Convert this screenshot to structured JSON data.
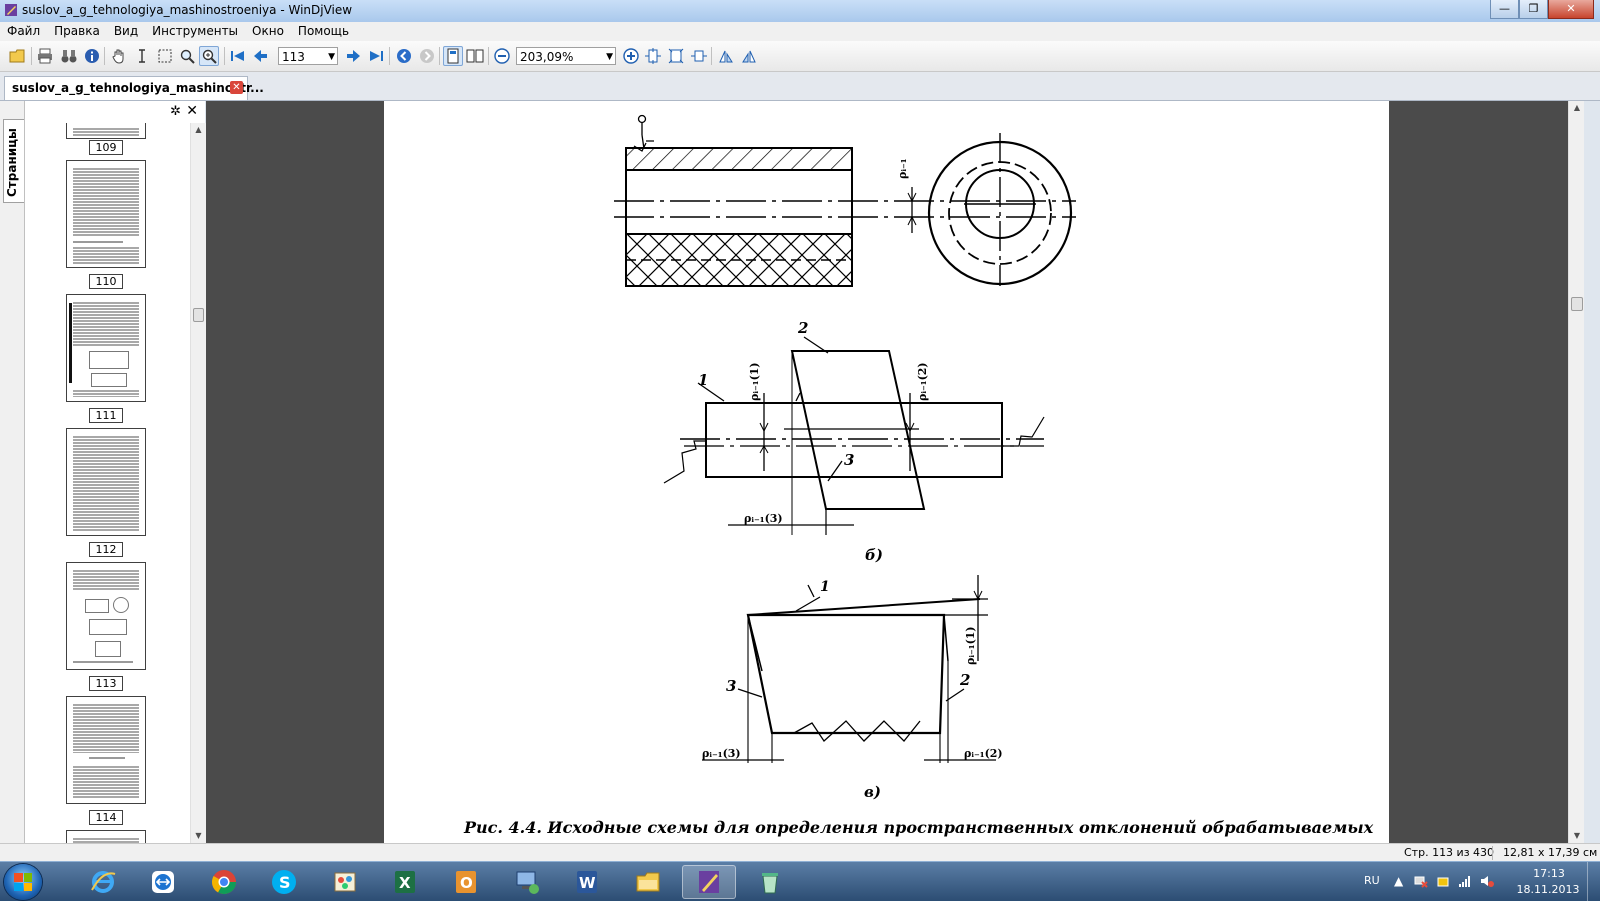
{
  "window": {
    "title": "suslov_a_g_tehnologiya_mashinostroeniya - WinDjView",
    "min_glyph": "—",
    "max_glyph": "❐",
    "close_glyph": "✕"
  },
  "menu": [
    "Файл",
    "Правка",
    "Вид",
    "Инструменты",
    "Окно",
    "Помощь"
  ],
  "toolbar": {
    "page_number": "113",
    "zoom": "203,09%"
  },
  "tab": {
    "title": "suslov_a_g_tehnologiya_mashinostr...",
    "close_glyph": "✕"
  },
  "sidebar": {
    "vertical_tab": "Страницы",
    "gear_glyph": "✲",
    "close_glyph": "✕",
    "thumbnails": [
      {
        "label": "109"
      },
      {
        "label": "110"
      },
      {
        "label": "111"
      },
      {
        "label": "112"
      },
      {
        "label": "113"
      },
      {
        "label": "114"
      }
    ]
  },
  "drawing": {
    "label_rho": "ρᵢ₋₁",
    "label_rho1": "ρᵢ₋₁(1)",
    "label_rho2": "ρᵢ₋₁(2)",
    "label_rho3": "ρᵢ₋₁(3)",
    "num1": "1",
    "num2": "2",
    "num3": "3",
    "sub_b": "б)",
    "sub_v": "в)",
    "caption": "Рис. 4.4. Исходные схемы для определения пространственных отклонений обрабатываемых"
  },
  "status": {
    "page": "Стр. 113 из 430",
    "size": "12,81 x 17,39 см"
  },
  "tray": {
    "lang": "RU",
    "time": "17:13",
    "date": "18.11.2013"
  },
  "taskbar": {
    "apps": [
      "ie",
      "teamviewer",
      "chrome",
      "skype",
      "paint",
      "excel",
      "outlook",
      "network-admin",
      "word",
      "explorer",
      "windjview",
      "recycle"
    ]
  }
}
